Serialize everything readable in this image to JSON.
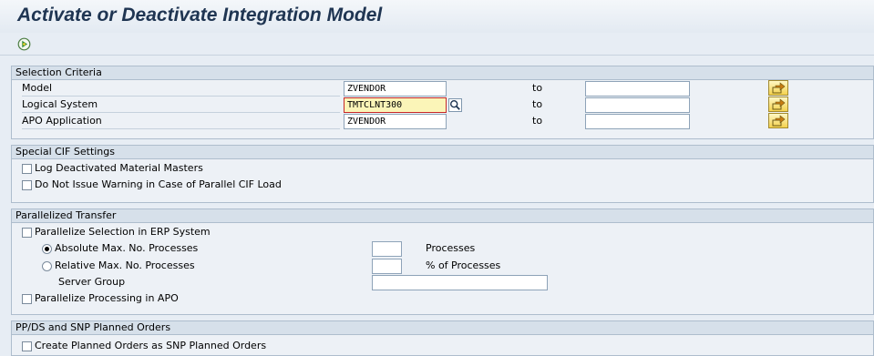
{
  "page_title": "Activate or Deactivate Integration Model",
  "toolbar": {
    "execute_icon": "execute-icon"
  },
  "selection_criteria": {
    "title": "Selection Criteria",
    "to_label": "to",
    "rows": [
      {
        "label": "Model",
        "value": "ZVENDOR",
        "to_value": ""
      },
      {
        "label": "Logical System",
        "value": "TMTCLNT300",
        "to_value": ""
      },
      {
        "label": "APO Application",
        "value": "ZVENDOR",
        "to_value": ""
      }
    ]
  },
  "special_cif": {
    "title": "Special CIF Settings",
    "options": [
      {
        "label": "Log Deactivated Material Masters",
        "checked": false
      },
      {
        "label": "Do Not Issue Warning in Case of Parallel CIF Load",
        "checked": false
      }
    ]
  },
  "parallelized_transfer": {
    "title": "Parallelized Transfer",
    "parallelize_erp": "Parallelize Selection in ERP System",
    "absolute_label": "Absolute Max. No. Processes",
    "absolute_unit": "Processes",
    "absolute_value": "",
    "relative_label": "Relative Max. No. Processes",
    "relative_unit": "% of Processes",
    "relative_value": "",
    "server_group_label": "Server Group",
    "server_group_value": "",
    "parallelize_apo": "Parallelize Processing in APO"
  },
  "planned_orders": {
    "title": "PP/DS and SNP Planned Orders",
    "create_snp": "Create Planned Orders as SNP Planned Orders"
  }
}
